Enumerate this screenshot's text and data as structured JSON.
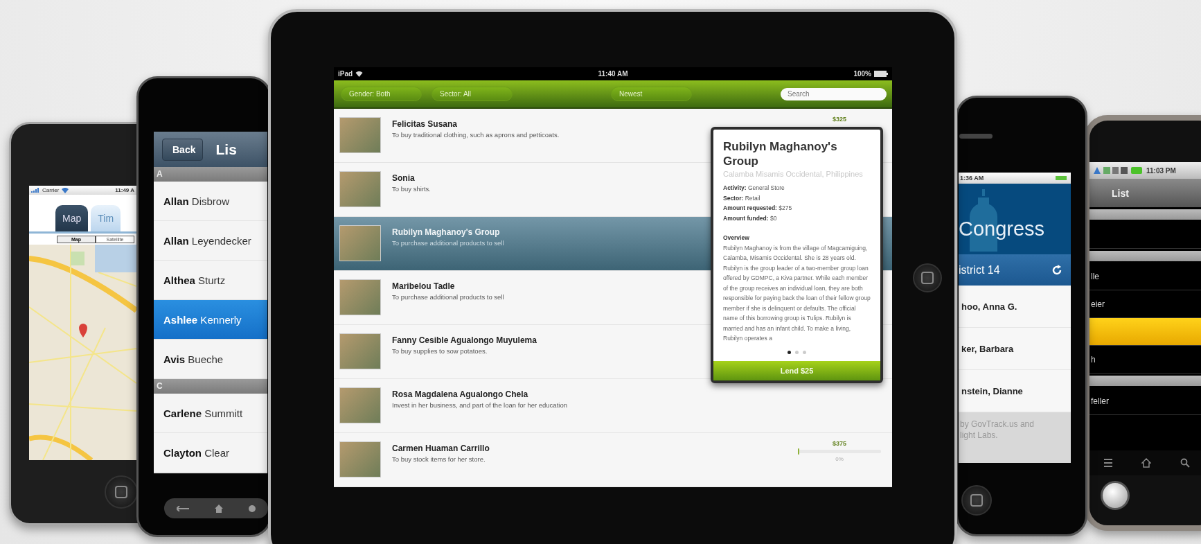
{
  "map_phone": {
    "status": {
      "carrier": "Carrier",
      "time": "11:49 A"
    },
    "tabs": [
      {
        "label": "Map",
        "selected": true
      },
      {
        "label": "Tim",
        "selected": false
      }
    ],
    "map_types": [
      {
        "label": "Map",
        "selected": true
      },
      {
        "label": "Satellite",
        "selected": false
      }
    ]
  },
  "list_phone": {
    "back": "Back",
    "title": "Lis",
    "sections": [
      {
        "letter": "A",
        "rows": [
          {
            "name": "**Allan** Disbrow",
            "selected": false
          },
          {
            "name": "**Allan** Leyendecker",
            "selected": false
          },
          {
            "name": "**Althea** Sturtz",
            "selected": false
          },
          {
            "name": "**Ashlee** Kennerly",
            "selected": true
          },
          {
            "name": "**Avis** Bueche",
            "selected": false
          }
        ]
      },
      {
        "letter": "C",
        "rows": [
          {
            "name": "**Carlene** Summitt",
            "selected": false
          },
          {
            "name": "**Clayton** Clear",
            "selected": false
          }
        ]
      }
    ]
  },
  "tablet": {
    "status": {
      "device": "iPad",
      "time": "11:40 AM",
      "battery": "100%"
    },
    "filters": [
      {
        "label": "Gender: Both"
      },
      {
        "label": "Sector: All"
      },
      {
        "label": "Newest"
      }
    ],
    "search": {
      "placeholder": "Search"
    },
    "loans": [
      {
        "name": "Felicitas Susana",
        "use": "To buy traditional clothing, such as aprons and petticoats.",
        "selected": false,
        "amount": "$325"
      },
      {
        "name": "Sonia",
        "use": "To buy shirts.",
        "selected": false
      },
      {
        "name": "Rubilyn Maghanoy's Group",
        "use": "To purchase additional products to sell",
        "selected": true
      },
      {
        "name": "Maribelou Tadle",
        "use": "To purchase additional products to sell",
        "selected": false
      },
      {
        "name": "Fanny Cesible Agualongo Muyulema",
        "use": "To buy supplies to sow potatoes.",
        "selected": false
      },
      {
        "name": "Rosa Magdalena Agualongo Chela",
        "use": "Invest in her business, and part of the loan for her education",
        "selected": false
      },
      {
        "name": "Carmen Huaman Carrillo",
        "use": "To buy stock items for her store.",
        "selected": false,
        "amount": "$375",
        "level": 0.02,
        "funded": "0%"
      }
    ],
    "popover": {
      "title": "Rubilyn Maghanoy's Group",
      "location": "Calamba Misamis Occidental, Philippines",
      "details": [
        "**Activity:** General Store",
        "**Sector:** Retail",
        "**Amount requested:** $275",
        "**Amount funded:** $0"
      ],
      "overview_label": "Overview",
      "overview": "Rubilyn Maghanoy is from the village of Magcamiguing, Calamba, Misamis Occidental. She is 28 years old. Rubilyn is the group leader of a two-member group loan offered by GDMPC, a Kiva partner. While each member of the group receives an individual loan, they are both responsible for paying back the loan of their fellow group member if she is delinquent or defaults. The official name of this borrowing group is Tulips. Rubilyn is married and has an infant child. To make a living, Rubilyn operates a",
      "pages": [
        {
          "selected": true
        },
        {
          "selected": false
        },
        {
          "selected": false
        }
      ],
      "button": "Lend $25"
    }
  },
  "congress_phone": {
    "status": {
      "time": "1:36 AM"
    },
    "title": "Congress",
    "district": "istrict 14",
    "members": [
      "hoo, Anna G.",
      "ker, Barbara",
      "nstein, Dianne"
    ],
    "footer": [
      "by GovTrack.us and",
      "light Labs."
    ]
  },
  "android_phone": {
    "status": {
      "time": "11:03 PM"
    },
    "title": "List",
    "rows": [
      {
        "kind": "header"
      },
      {
        "kind": "row",
        "selected": false
      },
      {
        "kind": "header"
      },
      {
        "kind": "row",
        "text": "lle",
        "selected": false
      },
      {
        "kind": "row",
        "text": "eier",
        "selected": false
      },
      {
        "kind": "row",
        "selected": true
      },
      {
        "kind": "row",
        "text": "h",
        "selected": false
      },
      {
        "kind": "header"
      },
      {
        "kind": "row",
        "text": "feller",
        "selected": false
      }
    ]
  }
}
